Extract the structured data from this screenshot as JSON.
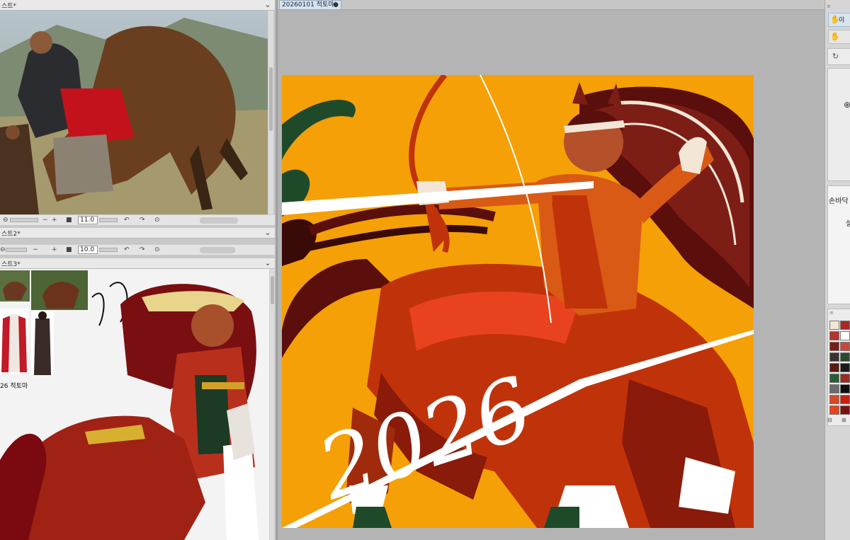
{
  "sub_views": [
    {
      "tab_label": "스트*",
      "zoom_value": "11.0"
    },
    {
      "tab_label": "스트2*",
      "zoom_value": "10.0"
    },
    {
      "tab_label": "스트3*"
    }
  ],
  "sketch_caption": "26 적토마",
  "document": {
    "tab_label": "20260101 적토마*",
    "modified_marker": "●"
  },
  "artwork_text": "2026",
  "right_panel": {
    "tool_label_1": "이",
    "sub_tool_label": "손바닥",
    "setting_label": "설",
    "add_symbol": "⊕"
  },
  "colors": {
    "artwork_bg": "#f4a006",
    "centaur_body": "#c0330a",
    "centaur_shadow": "#8a1a0a",
    "hair_dark": "#5b0f0c",
    "accent_green": "#1f4a2a",
    "brush_white": "#ffffff"
  },
  "swatches": [
    "#f3e6d6",
    "#a82a22",
    "#b3362c",
    "#ffffff",
    "#7a1c16",
    "#c7483a",
    "#3a3330",
    "#2a4a2e",
    "#5a1a12",
    "#1a1a1a",
    "#2b5b34",
    "#9d2a1c",
    "#6b6b6b",
    "#0e0e0e",
    "#d64a2a",
    "#cc1e10",
    "#e8431e",
    "#7a1212"
  ]
}
